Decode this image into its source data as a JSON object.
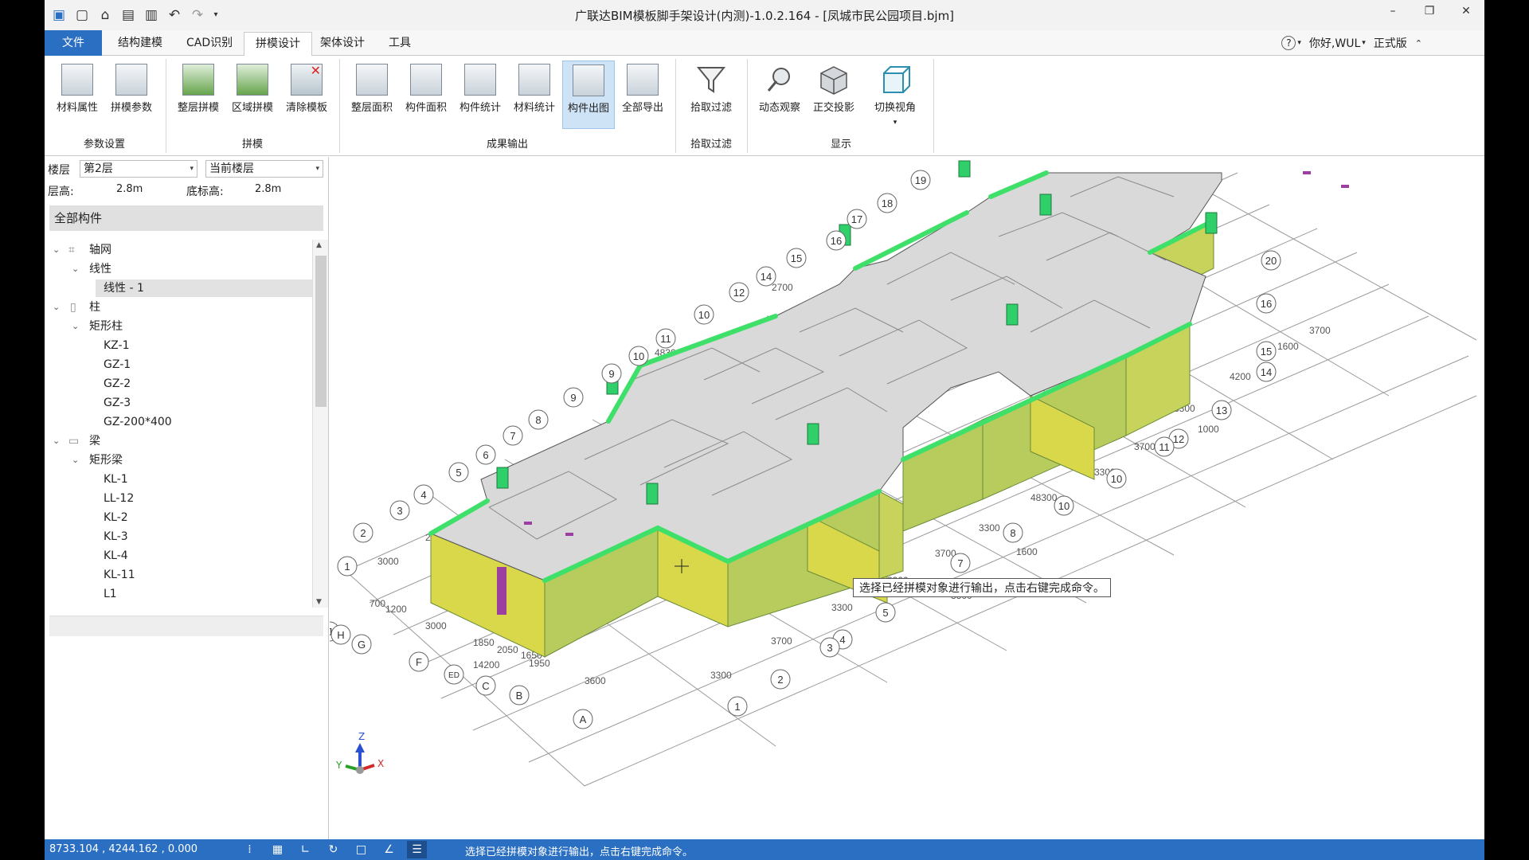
{
  "window": {
    "title": "广联达BIM模板脚手架设计(内测)-1.0.2.164 - [凤城市民公园项目.bjm]",
    "controls": [
      "–",
      "❐",
      "✕"
    ]
  },
  "quick_access": [
    "app-logo-icon",
    "new-file-icon",
    "open-folder-icon",
    "save-icon",
    "save-as-icon",
    "undo-icon",
    "redo-icon",
    "customize-dropdown-icon"
  ],
  "menu": {
    "tabs": [
      "文件",
      "结构建模",
      "CAD识别",
      "拼模设计",
      "架体设计",
      "工具"
    ],
    "active": "拼模设计",
    "help": "?",
    "user": "你好,WUL",
    "edition": "正式版"
  },
  "ribbon": {
    "groups": [
      {
        "label": "参数设置",
        "buttons": [
          "材料属性",
          "拼模参数"
        ]
      },
      {
        "label": "拼模",
        "buttons": [
          "整层拼模",
          "区域拼模",
          "清除模板"
        ]
      },
      {
        "label": "成果输出",
        "buttons": [
          "整层面积",
          "构件面积",
          "构件统计",
          "材料统计",
          "构件出图",
          "全部导出"
        ]
      },
      {
        "label": "拾取过滤",
        "buttons": [
          "拾取过滤"
        ]
      },
      {
        "label": "显示",
        "buttons": [
          "动态观察",
          "正交投影",
          "切换视角"
        ]
      }
    ],
    "active_button": "构件出图"
  },
  "left_panel": {
    "floor_label": "楼层",
    "floor_value": "第2层",
    "scope_value": "当前楼层",
    "layer_height_label": "层高:",
    "layer_height_value": "2.8m",
    "bottom_elev_label": "底标高:",
    "bottom_elev_value": "2.8m",
    "all_parts": "全部构件",
    "tree": [
      {
        "level": 0,
        "label": "轴网",
        "expanded": true
      },
      {
        "level": 1,
        "label": "线性",
        "expanded": true
      },
      {
        "level": 2,
        "label": "线性 - 1",
        "selected": true
      },
      {
        "level": 0,
        "label": "柱",
        "expanded": true
      },
      {
        "level": 1,
        "label": "矩形柱",
        "expanded": true
      },
      {
        "level": 2,
        "label": "KZ-1"
      },
      {
        "level": 2,
        "label": "GZ-1"
      },
      {
        "level": 2,
        "label": "GZ-2"
      },
      {
        "level": 2,
        "label": "GZ-3"
      },
      {
        "level": 2,
        "label": "GZ-200*400"
      },
      {
        "level": 0,
        "label": "梁",
        "expanded": true
      },
      {
        "level": 1,
        "label": "矩形梁",
        "expanded": true
      },
      {
        "level": 2,
        "label": "KL-1"
      },
      {
        "level": 2,
        "label": "LL-12"
      },
      {
        "level": 2,
        "label": "KL-2"
      },
      {
        "level": 2,
        "label": "KL-3"
      },
      {
        "level": 2,
        "label": "KL-4"
      },
      {
        "level": 2,
        "label": "KL-11"
      },
      {
        "level": 2,
        "label": "L1"
      }
    ]
  },
  "viewport": {
    "tooltip": "选择已经拼模对象进行输出，点击右键完成命令。",
    "axis_gizmo": {
      "z": "Z",
      "x": "X",
      "y": "Y"
    },
    "grid_bubbles_top": [
      "1",
      "2",
      "3",
      "4",
      "5",
      "6",
      "7",
      "8",
      "9",
      "9",
      "10",
      "11",
      "10",
      "12",
      "14",
      "15",
      "16",
      "17",
      "18",
      "19"
    ],
    "grid_bubbles_right": [
      "20",
      "16",
      "15",
      "14",
      "13",
      "12",
      "11",
      "10",
      "10",
      "8",
      "7",
      "5",
      "4",
      "3",
      "2",
      "1"
    ],
    "grid_bubbles_bottom": [
      "J",
      "H",
      "G",
      "F",
      "ED",
      "C",
      "B",
      "A"
    ],
    "dimensions": [
      "3000",
      "2700",
      "2700",
      "48300",
      "1200",
      "700",
      "3000",
      "1850",
      "2050",
      "1650",
      "14200",
      "1950",
      "3600",
      "3300",
      "3700",
      "3300",
      "3300",
      "3700",
      "3300",
      "48300",
      "3300",
      "3700",
      "1600",
      "3300",
      "3300",
      "4200",
      "1600",
      "3700",
      "1000"
    ]
  },
  "status_bar": {
    "coords": "8733.104 , 4244.162 , 0.000",
    "tools": [
      "snap-grid-icon",
      "grid-icon",
      "ortho-icon",
      "rotate-icon",
      "rect-icon",
      "angle-icon",
      "list-icon"
    ],
    "message": "选择已经拼模对象进行输出，点击右键完成命令。"
  },
  "colors": {
    "brand_blue": "#2b6fc2",
    "active_button_bg": "#cfe3f6",
    "slab_gray": "#d9d9d9",
    "edge_green": "#3fe06a",
    "panel_yellow": "#d8d84a",
    "purple_marker": "#9b3fa0"
  }
}
